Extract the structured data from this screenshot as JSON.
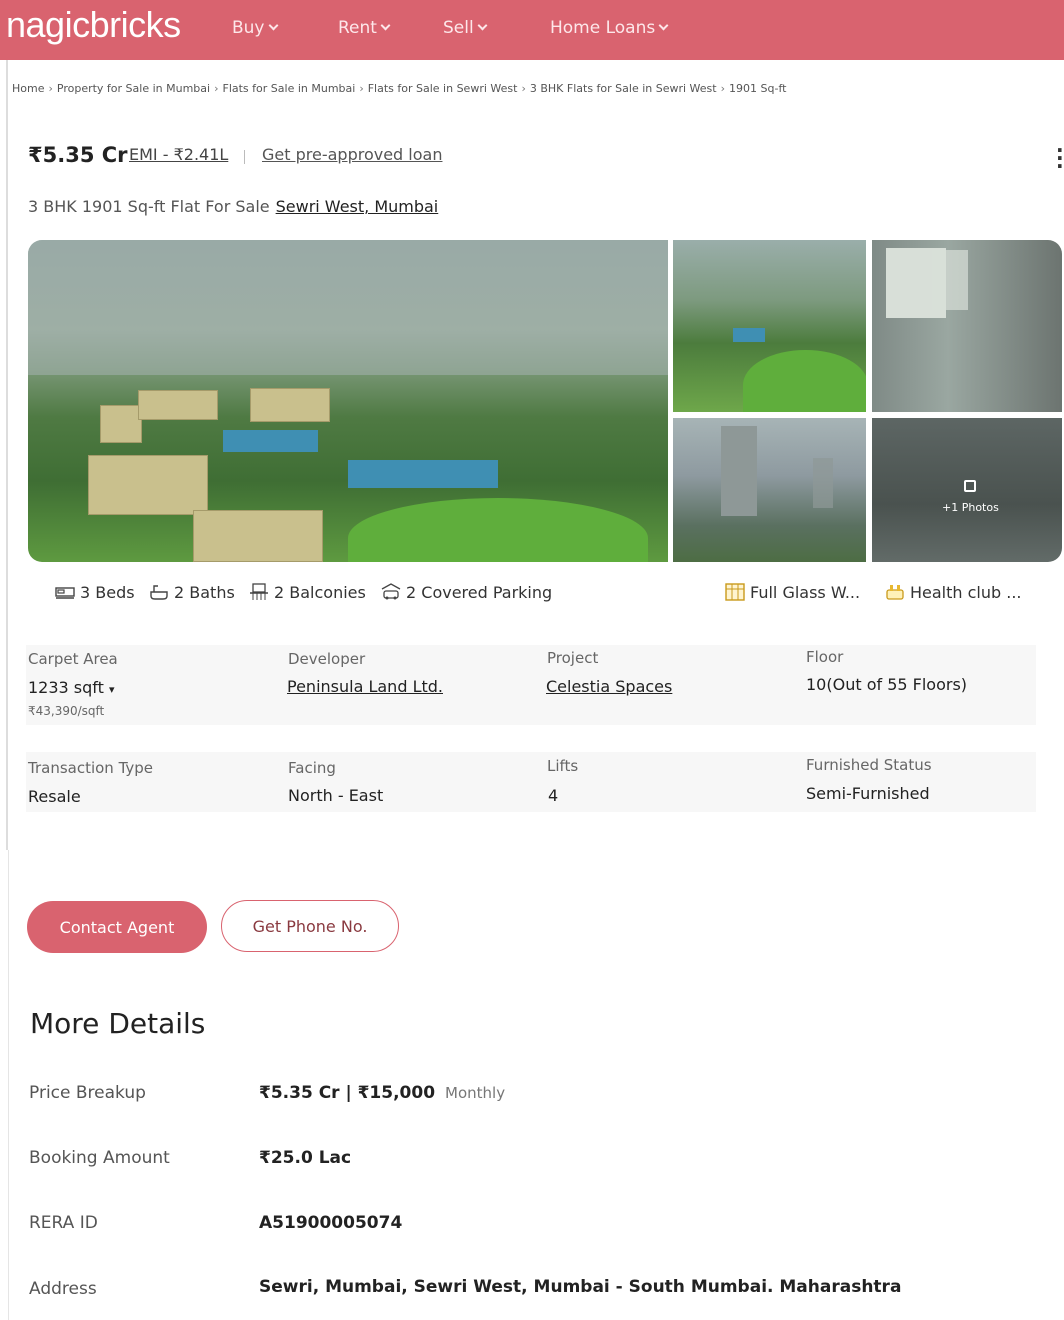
{
  "header": {
    "logo": "nagicbricks",
    "nav": [
      {
        "label": "Buy"
      },
      {
        "label": "Rent"
      },
      {
        "label": "Sell"
      },
      {
        "label": "Home Loans"
      }
    ]
  },
  "breadcrumb": [
    "Home",
    "Property for Sale in Mumbai",
    "Flats for Sale in Mumbai",
    "Flats for Sale in Sewri West",
    "3 BHK Flats for Sale in Sewri West",
    "1901 Sq-ft"
  ],
  "listing": {
    "price": "₹5.35 Cr",
    "emi": "EMI - ₹2.41L",
    "preapproved": "Get pre-approved loan",
    "title": "3 BHK 1901 Sq-ft Flat For Sale",
    "location": "Sewri West, Mumbai"
  },
  "gallery": {
    "more_photos": "+1 Photos"
  },
  "amenities": [
    {
      "icon": "bed-icon",
      "label": "3 Beds"
    },
    {
      "icon": "bath-icon",
      "label": "2 Baths"
    },
    {
      "icon": "balcony-icon",
      "label": "2 Balconies"
    },
    {
      "icon": "car-icon",
      "label": "2 Covered Parking"
    },
    {
      "icon": "window-icon",
      "label": "Full Glass W..."
    },
    {
      "icon": "health-club-icon",
      "label": "Health club ..."
    }
  ],
  "details": {
    "carpet_area": {
      "label": "Carpet Area",
      "value": "1233 sqft",
      "sub": "₹43,390/sqft"
    },
    "developer": {
      "label": "Developer",
      "value": "Peninsula Land Ltd."
    },
    "project": {
      "label": "Project",
      "value": "Celestia Spaces"
    },
    "floor": {
      "label": "Floor",
      "value": "10(Out of 55 Floors)"
    },
    "transaction": {
      "label": "Transaction Type",
      "value": "Resale"
    },
    "facing": {
      "label": "Facing",
      "value": "North - East"
    },
    "lifts": {
      "label": "Lifts",
      "value": "4"
    },
    "furnished": {
      "label": "Furnished Status",
      "value": "Semi-Furnished"
    }
  },
  "actions": {
    "contact": "Contact Agent",
    "phone": "Get Phone No."
  },
  "more_details": {
    "title": "More Details",
    "rows": [
      {
        "label": "Price Breakup",
        "value": "₹5.35 Cr | ₹15,000",
        "note": "Monthly"
      },
      {
        "label": "Booking Amount",
        "value": "₹25.0 Lac"
      },
      {
        "label": "RERA ID",
        "value": "A51900005074"
      },
      {
        "label": "Address",
        "value": "Sewri, Mumbai, Sewri West, Mumbai - South Mumbai. Maharashtra"
      }
    ]
  },
  "colors": {
    "brand": "#d9636f"
  }
}
